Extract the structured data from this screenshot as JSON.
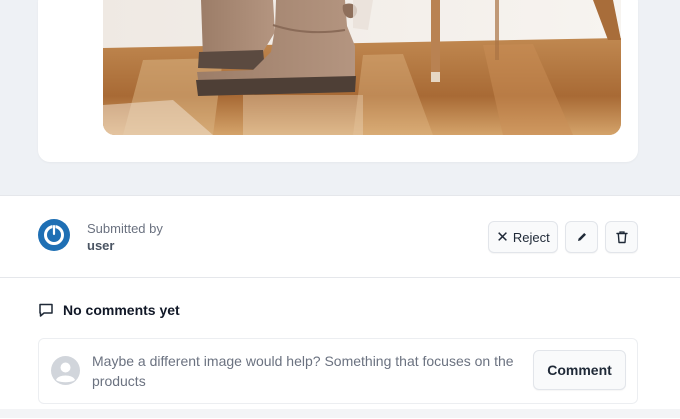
{
  "submission": {
    "submitted_by_label": "Submitted by",
    "submitted_by_user": "user"
  },
  "actions": {
    "reject_label": "Reject",
    "edit_icon": "pencil-icon",
    "delete_icon": "trash-icon"
  },
  "comments": {
    "header": "No comments yet",
    "draft_text": "Maybe a different image would help? Something that focuses on the products",
    "submit_label": "Comment"
  },
  "colors": {
    "avatar_brand": "#1e6fb4",
    "page_background": "#eef1f5"
  }
}
